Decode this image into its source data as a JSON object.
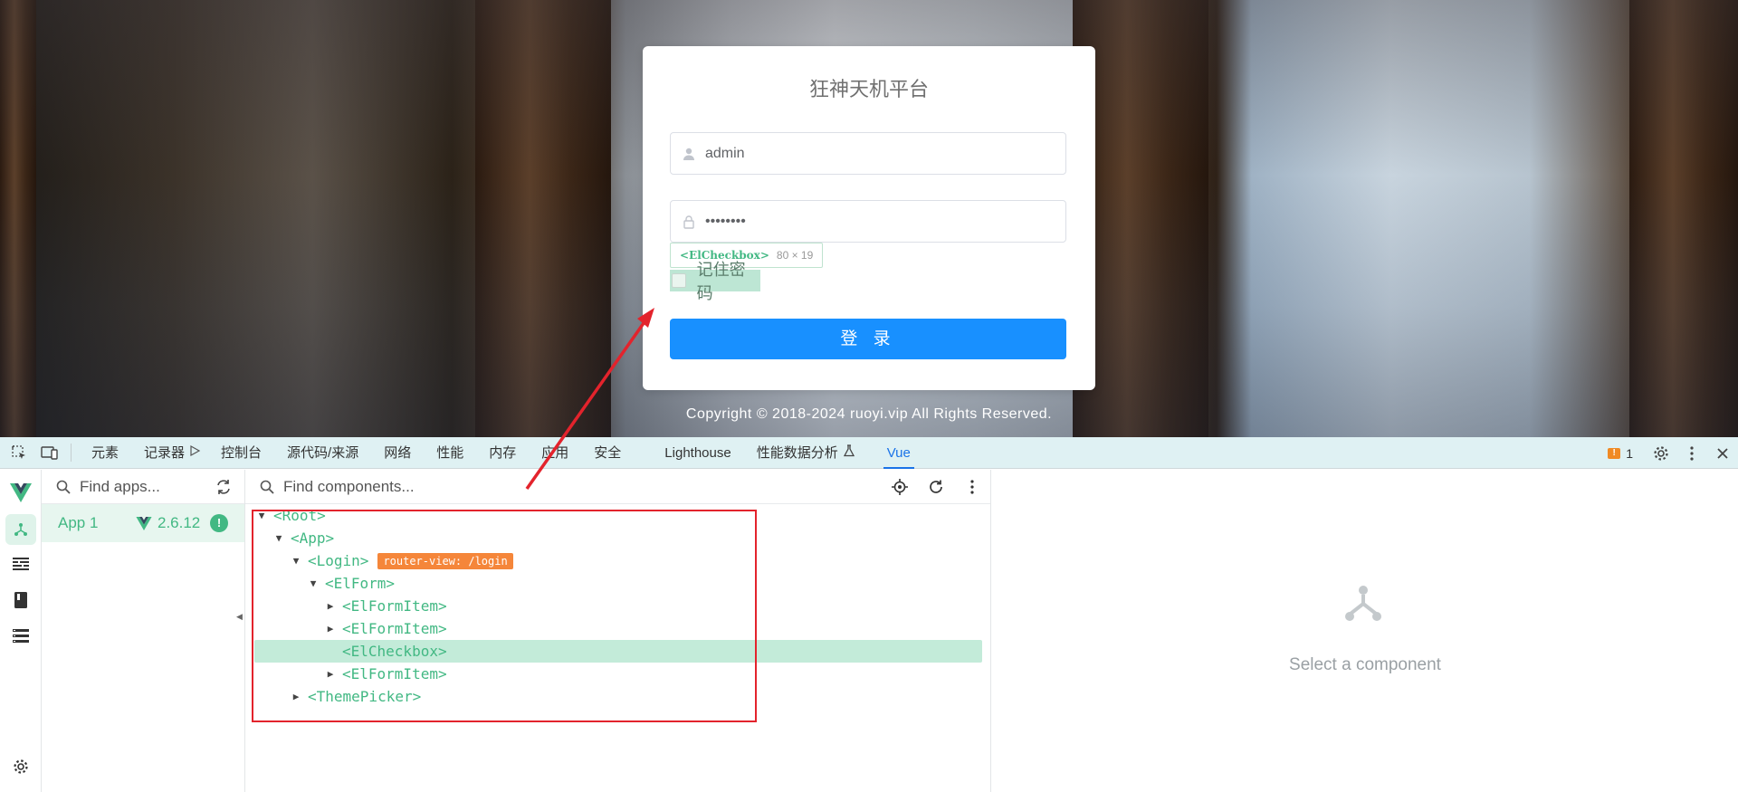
{
  "login": {
    "title": "狂神天机平台",
    "username_value": "admin",
    "password_value": "••••••••",
    "inspect_tag": "<ElCheckbox>",
    "inspect_dims": "80 × 19",
    "remember_label": "记住密码",
    "login_button": "登 录",
    "copyright": "Copyright © 2018-2024 ruoyi.vip All Rights Reserved."
  },
  "devtools": {
    "tabs": [
      "元素",
      "记录器",
      "控制台",
      "源代码/来源",
      "网络",
      "性能",
      "内存",
      "应用",
      "安全",
      "Lighthouse",
      "性能数据分析",
      "Vue"
    ],
    "active_tab": "Vue",
    "issues_count": "1",
    "apps_search_placeholder": "Find apps...",
    "components_search_placeholder": "Find components...",
    "app": {
      "name": "App 1",
      "version": "2.6.12",
      "warning": "!"
    },
    "tree": [
      {
        "label": "<Root>",
        "depth": 0,
        "arrow": "open"
      },
      {
        "label": "<App>",
        "depth": 1,
        "arrow": "open"
      },
      {
        "label": "<Login>",
        "depth": 2,
        "arrow": "open",
        "badge": "router-view: /login"
      },
      {
        "label": "<ElForm>",
        "depth": 3,
        "arrow": "open"
      },
      {
        "label": "<ElFormItem>",
        "depth": 4,
        "arrow": "closed"
      },
      {
        "label": "<ElFormItem>",
        "depth": 4,
        "arrow": "closed"
      },
      {
        "label": "<ElCheckbox>",
        "depth": 4,
        "arrow": "none",
        "selected": true
      },
      {
        "label": "<ElFormItem>",
        "depth": 4,
        "arrow": "closed"
      },
      {
        "label": "<ThemePicker>",
        "depth": 2,
        "arrow": "closed"
      }
    ],
    "detail_placeholder": "Select a component"
  },
  "colors": {
    "vue_green": "#42b883",
    "login_button": "#1890ff",
    "annotation_red": "#e3232c",
    "router_badge": "#f5863a"
  }
}
